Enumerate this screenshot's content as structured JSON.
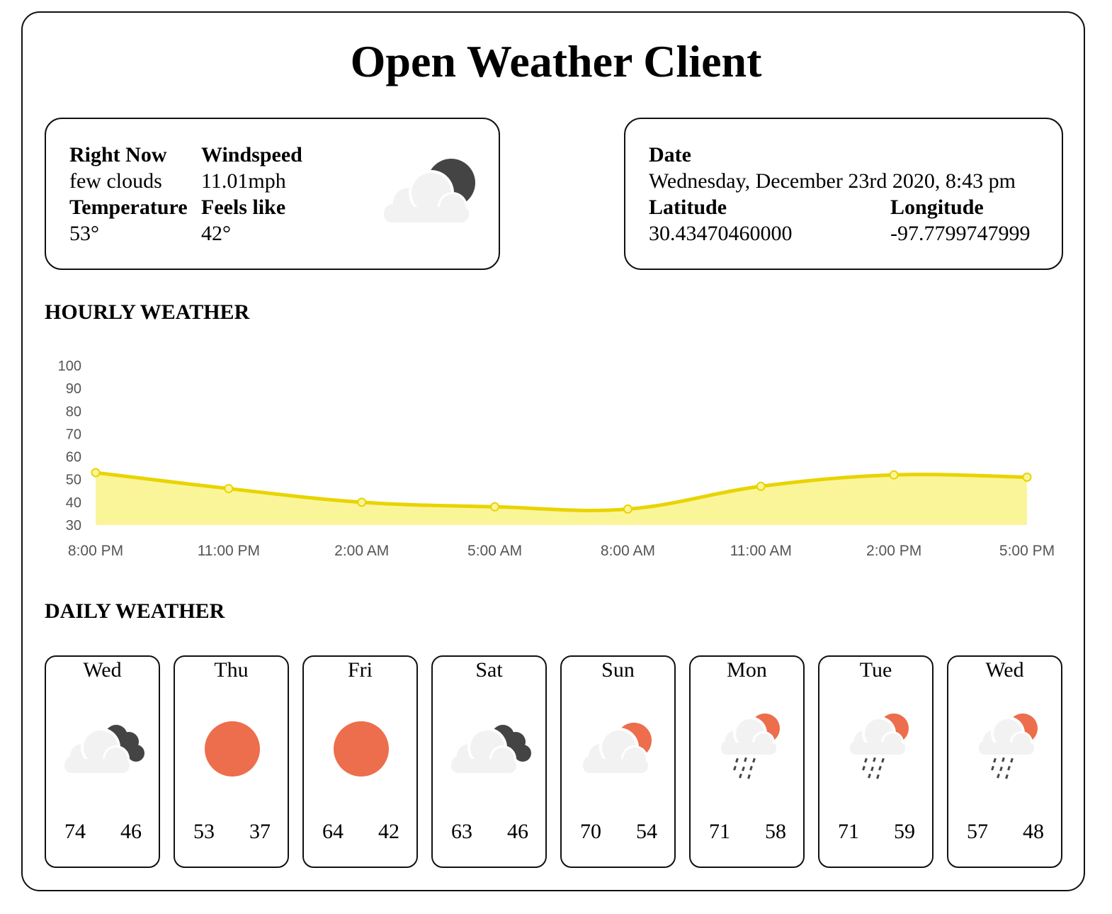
{
  "app": {
    "title": "Open Weather Client"
  },
  "current": {
    "right_now_label": "Right Now",
    "right_now_value": "few clouds",
    "windspeed_label": "Windspeed",
    "windspeed_value": "11.01mph",
    "temperature_label": "Temperature",
    "temperature_value": "53°",
    "feels_like_label": "Feels like",
    "feels_like_value": "42°",
    "icon": "few-clouds-night-icon"
  },
  "location": {
    "date_label": "Date",
    "date_value": "Wednesday, December 23rd 2020, 8:43 pm",
    "latitude_label": "Latitude",
    "latitude_value": "30.43470460000",
    "longitude_label": "Longitude",
    "longitude_value": "-97.7799747999"
  },
  "hourly": {
    "title": "HOURLY WEATHER"
  },
  "chart_data": {
    "type": "area",
    "title": "",
    "xlabel": "",
    "ylabel": "",
    "x": [
      "8:00 PM",
      "11:00 PM",
      "2:00 AM",
      "5:00 AM",
      "8:00 AM",
      "11:00 AM",
      "2:00 PM",
      "5:00 PM"
    ],
    "values": [
      53,
      46,
      40,
      38,
      37,
      47,
      52,
      51
    ],
    "yticks": [
      30,
      40,
      50,
      60,
      70,
      80,
      90,
      100
    ],
    "ylim": [
      30,
      100
    ],
    "grid": false,
    "legend": "none",
    "line_color": "#e8d400",
    "fill_color": "#fbf59a"
  },
  "daily": {
    "title": "DAILY WEATHER",
    "days": [
      {
        "day": "Wed",
        "high": "74",
        "low": "46",
        "icon": "cloud-dark-cloud-icon"
      },
      {
        "day": "Thu",
        "high": "53",
        "low": "37",
        "icon": "sun-icon"
      },
      {
        "day": "Fri",
        "high": "64",
        "low": "42",
        "icon": "sun-icon"
      },
      {
        "day": "Sat",
        "high": "63",
        "low": "46",
        "icon": "cloud-dark-cloud-icon"
      },
      {
        "day": "Sun",
        "high": "70",
        "low": "54",
        "icon": "partly-cloudy-icon"
      },
      {
        "day": "Mon",
        "high": "71",
        "low": "58",
        "icon": "rain-partly-cloudy-icon"
      },
      {
        "day": "Tue",
        "high": "71",
        "low": "59",
        "icon": "rain-partly-cloudy-icon"
      },
      {
        "day": "Wed",
        "high": "57",
        "low": "48",
        "icon": "rain-partly-cloudy-icon"
      }
    ]
  },
  "colors": {
    "sun": "#ec6e4c",
    "cloud": "#f2f2f2",
    "dark_cloud": "#444444",
    "rain": "#444444"
  }
}
